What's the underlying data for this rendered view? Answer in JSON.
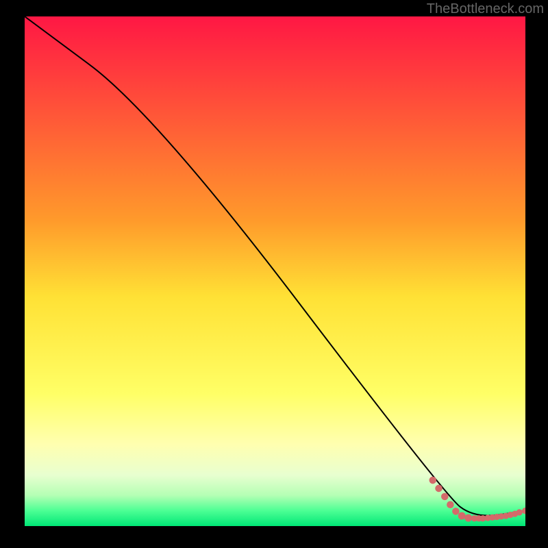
{
  "watermark": "TheBottleneck.com",
  "chart_data": {
    "type": "line",
    "title": "",
    "xlabel": "",
    "ylabel": "",
    "xlim": [
      0,
      100
    ],
    "ylim": [
      0,
      100
    ],
    "gradient_stops": [
      {
        "offset": 0,
        "color": "#ff1744"
      },
      {
        "offset": 40,
        "color": "#ff9a2b"
      },
      {
        "offset": 55,
        "color": "#ffe135"
      },
      {
        "offset": 74,
        "color": "#ffff66"
      },
      {
        "offset": 84,
        "color": "#ffffb0"
      },
      {
        "offset": 90,
        "color": "#e8ffd0"
      },
      {
        "offset": 94,
        "color": "#b4ffb4"
      },
      {
        "offset": 97,
        "color": "#4cff94"
      },
      {
        "offset": 100,
        "color": "#00e676"
      }
    ],
    "curve": {
      "x": [
        0,
        26,
        84,
        90,
        100
      ],
      "y": [
        100,
        81,
        6,
        1.5,
        3
      ]
    },
    "markers": {
      "color": "#d46a6a",
      "points": [
        {
          "x": 81.5,
          "y": 9.0,
          "r": 3.2
        },
        {
          "x": 82.7,
          "y": 7.4,
          "r": 3.2
        },
        {
          "x": 83.9,
          "y": 5.8,
          "r": 3.2
        },
        {
          "x": 85.0,
          "y": 4.2,
          "r": 3.2
        },
        {
          "x": 86.1,
          "y": 2.9,
          "r": 3.2
        },
        {
          "x": 87.3,
          "y": 2.0,
          "r": 3.4
        },
        {
          "x": 88.6,
          "y": 1.6,
          "r": 3.4
        },
        {
          "x": 89.8,
          "y": 1.5,
          "r": 2.6
        },
        {
          "x": 90.7,
          "y": 1.5,
          "r": 2.6
        },
        {
          "x": 91.5,
          "y": 1.5,
          "r": 2.6
        },
        {
          "x": 92.5,
          "y": 1.6,
          "r": 2.6
        },
        {
          "x": 93.4,
          "y": 1.7,
          "r": 2.6
        },
        {
          "x": 94.3,
          "y": 1.8,
          "r": 2.6
        },
        {
          "x": 95.2,
          "y": 1.9,
          "r": 2.6
        },
        {
          "x": 96.1,
          "y": 2.0,
          "r": 2.6
        },
        {
          "x": 97.0,
          "y": 2.2,
          "r": 2.6
        },
        {
          "x": 97.9,
          "y": 2.4,
          "r": 2.6
        },
        {
          "x": 98.8,
          "y": 2.7,
          "r": 2.6
        },
        {
          "x": 100.0,
          "y": 3.0,
          "r": 2.8
        }
      ]
    }
  }
}
